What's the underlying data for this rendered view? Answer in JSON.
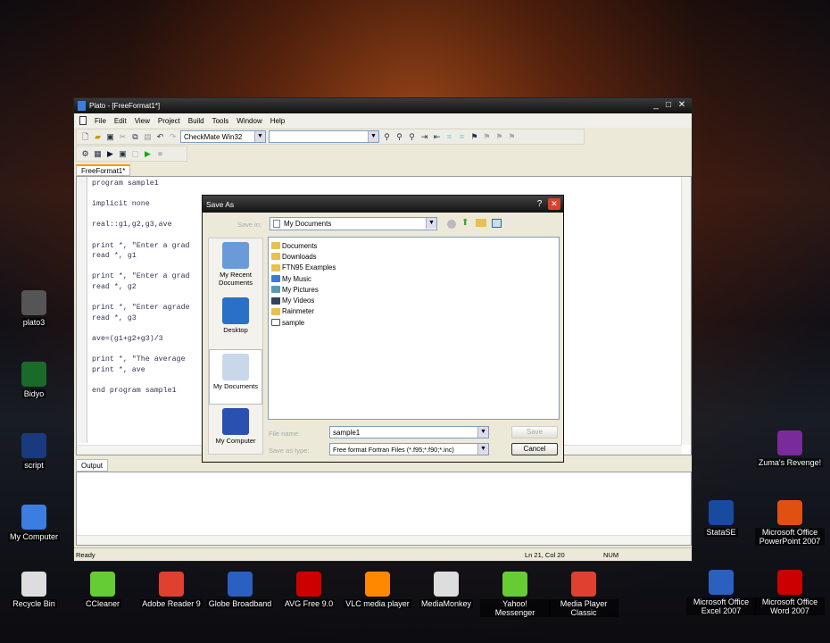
{
  "desktop": {
    "left_icons": [
      {
        "label": "plato3"
      },
      {
        "label": "Bidyo"
      },
      {
        "label": "script"
      },
      {
        "label": "My Computer"
      }
    ],
    "bottom_icons": [
      {
        "label": "Recycle Bin"
      },
      {
        "label": "CCleaner"
      },
      {
        "label": "Adobe Reader 9"
      },
      {
        "label": "Globe Broadband"
      },
      {
        "label": "AVG Free 9.0"
      },
      {
        "label": "VLC media player"
      },
      {
        "label": "MediaMonkey"
      },
      {
        "label": "Yahoo! Messenger"
      },
      {
        "label": "Media Player Classic"
      },
      {
        "label": "Microsoft Office Excel 2007"
      },
      {
        "label": "Microsoft Office Word 2007"
      }
    ],
    "right_icons": [
      {
        "label": "Zuma's Revenge!"
      },
      {
        "label": "StataSE"
      },
      {
        "label": "Microsoft Office PowerPoint 2007"
      }
    ]
  },
  "window": {
    "title": "Plato - [FreeFormat1*]",
    "menu": [
      "File",
      "Edit",
      "View",
      "Project",
      "Build",
      "Tools",
      "Window",
      "Help"
    ],
    "config_combo": "CheckMate Win32",
    "second_combo": "",
    "tab": "FreeFormat1*",
    "code": [
      "program sample1",
      "",
      "implicit none",
      "",
      "real::g1,g2,g3,ave",
      "",
      "print *, \"Enter a grad",
      "read *, g1",
      "",
      "print *, \"Enter a grad",
      "read *, g2",
      "",
      "print *, \"Enter agrade",
      "read *, g3",
      "",
      "ave=(g1+g2+g3)/3",
      "",
      "print *, \"The average",
      "print *, ave",
      "",
      "end program sample1"
    ],
    "output_tab": "Output",
    "status": {
      "ready": "Ready",
      "position": "Ln 21, Col 20",
      "num": "NUM"
    }
  },
  "dialog": {
    "title": "Save As",
    "save_in_label": "Save in:",
    "save_in_value": "My Documents",
    "places": [
      "My Recent Documents",
      "Desktop",
      "My Documents",
      "My Computer"
    ],
    "files": [
      {
        "name": "Documents",
        "type": "folder"
      },
      {
        "name": "Downloads",
        "type": "folder"
      },
      {
        "name": "FTN95 Examples",
        "type": "folder"
      },
      {
        "name": "My Music",
        "type": "music"
      },
      {
        "name": "My Pictures",
        "type": "pictures"
      },
      {
        "name": "My Videos",
        "type": "videos"
      },
      {
        "name": "Rainmeter",
        "type": "folder"
      },
      {
        "name": "sample",
        "type": "file"
      }
    ],
    "file_name_label": "File name:",
    "file_name": "sample1",
    "save_type_label": "Save as type:",
    "save_type": "Free format Fortran Files (*.f95;*.f90;*.inc)",
    "save_button": "Save",
    "cancel_button": "Cancel"
  }
}
